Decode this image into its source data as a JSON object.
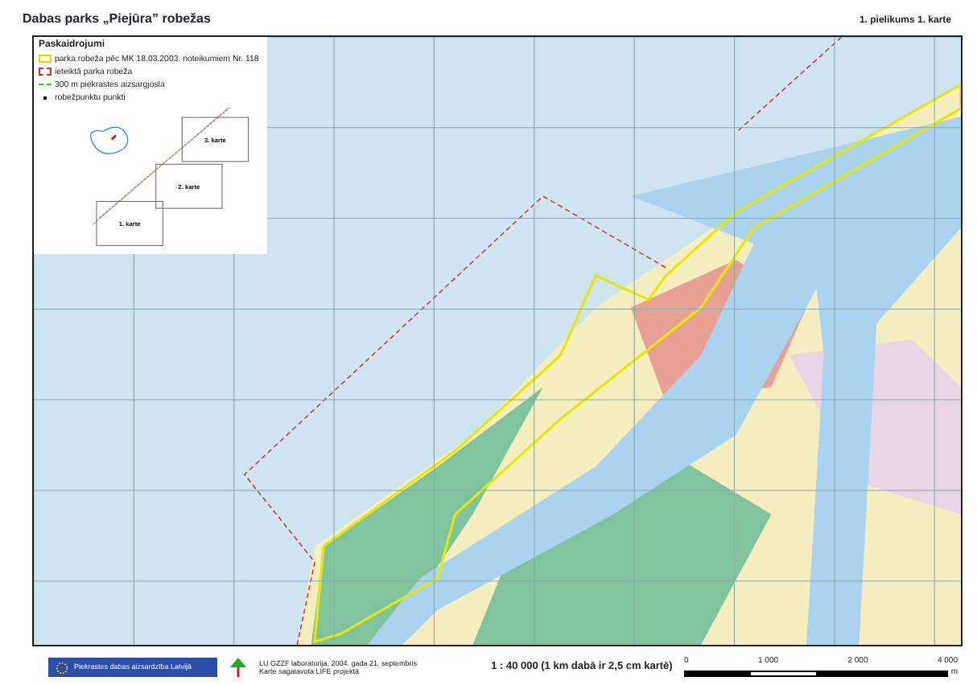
{
  "title": "Dabas parks „Piejūra” robežas",
  "sheet_label": "1. pielikums 1. karte",
  "legend": {
    "title": "Paskaidrojumi",
    "items": [
      {
        "kind": "park-boundary",
        "label": "parka robeža pēc MK 18.03.2003. noteikumiem Nr. 118"
      },
      {
        "kind": "proposed-boundary",
        "label": "ieteiktā parka robeža"
      },
      {
        "kind": "protection-zone",
        "label": "300 m piekrastes aizsargjosla"
      },
      {
        "kind": "boundary-point",
        "label": "robežpunktu punkti"
      }
    ]
  },
  "inset": {
    "sheets": [
      "3. karte",
      "2. karte",
      "1. karte"
    ]
  },
  "footer": {
    "logo_text": "Piekrastes dabas aizsardzība Latvijā",
    "credit_lines": [
      "LU ĢZZF laboratorija, 2004. gada 21. septembris",
      "Karte sagatavota LIFE projektā"
    ]
  },
  "scale": {
    "text": "1 : 40 000 (1 km dabā ir 2,5 cm kartē)",
    "ticks": [
      "0",
      "1 000",
      "2 000",
      "4 000"
    ],
    "unit": "m"
  }
}
